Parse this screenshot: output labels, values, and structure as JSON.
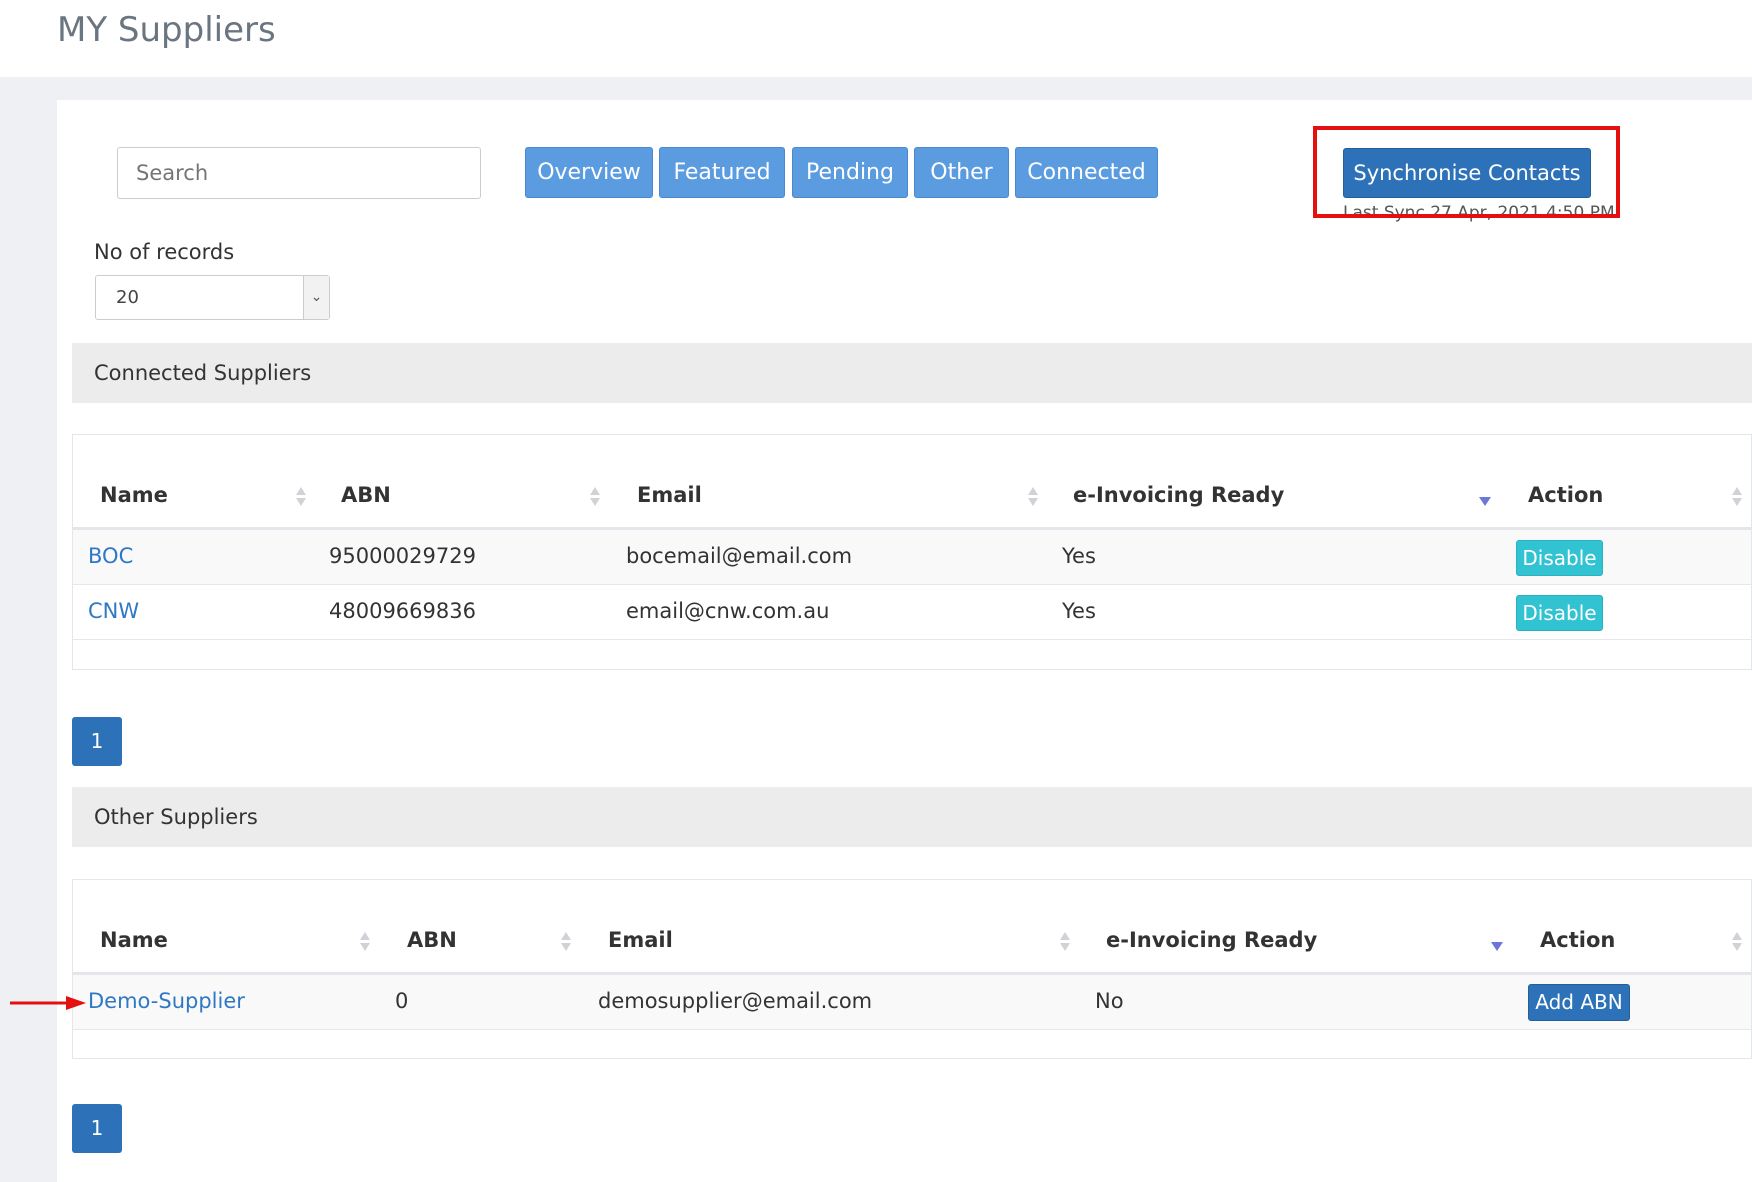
{
  "page": {
    "title": "MY Suppliers"
  },
  "search": {
    "placeholder": "Search"
  },
  "tabs": [
    {
      "label": "Overview"
    },
    {
      "label": "Featured"
    },
    {
      "label": "Pending"
    },
    {
      "label": "Other"
    },
    {
      "label": "Connected"
    }
  ],
  "sync": {
    "button_label": "Synchronise Contacts",
    "last_sync": "Last Sync 27 Apr, 2021 4:50 PM"
  },
  "records": {
    "label": "No of records",
    "value": "20"
  },
  "connected": {
    "title": "Connected Suppliers",
    "headers": [
      "Name",
      "ABN",
      "Email",
      "e-Invoicing Ready",
      "Action"
    ],
    "rows": [
      {
        "name": "BOC",
        "abn": "95000029729",
        "email": "bocemail@email.com",
        "ready": "Yes",
        "action": "Disable"
      },
      {
        "name": "CNW",
        "abn": "48009669836",
        "email": "email@cnw.com.au",
        "ready": "Yes",
        "action": "Disable"
      }
    ],
    "page": "1"
  },
  "other": {
    "title": "Other Suppliers",
    "headers": [
      "Name",
      "ABN",
      "Email",
      "e-Invoicing Ready",
      "Action"
    ],
    "rows": [
      {
        "name": "Demo-Supplier",
        "abn": "0",
        "email": "demosupplier@email.com",
        "ready": "No",
        "action": "Add ABN"
      }
    ],
    "page": "1"
  },
  "colors": {
    "accent": "#2d72b8",
    "tab": "#5b9be0",
    "disable": "#31c3d1",
    "annotation": "#e41010"
  }
}
